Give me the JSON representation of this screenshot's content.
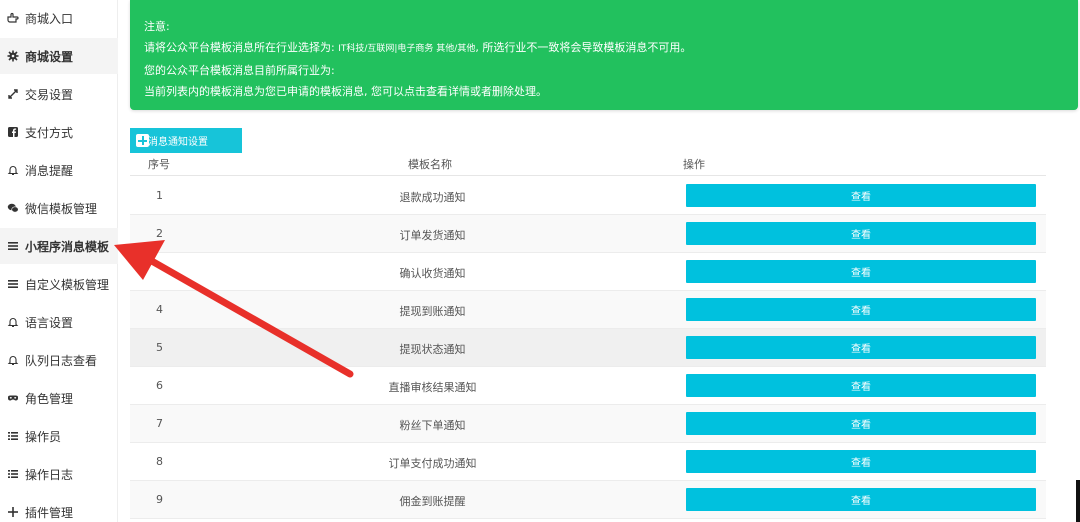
{
  "sidebar": {
    "items": [
      {
        "label": "商城入口",
        "icon": "hand-point-icon"
      },
      {
        "label": "商城设置",
        "icon": "gear-icon",
        "active": true
      },
      {
        "label": "交易设置",
        "icon": "swap-icon"
      },
      {
        "label": "支付方式",
        "icon": "facebook-square-icon"
      },
      {
        "label": "消息提醒",
        "icon": "bell-icon"
      },
      {
        "label": "微信模板管理",
        "icon": "wechat-icon"
      },
      {
        "label": "小程序消息模板",
        "icon": "list-icon",
        "highlighted": true
      },
      {
        "label": "自定义模板管理",
        "icon": "list-icon"
      },
      {
        "label": "语言设置",
        "icon": "bell-icon"
      },
      {
        "label": "队列日志查看",
        "icon": "bell-icon"
      },
      {
        "label": "角色管理",
        "icon": "mask-icon"
      },
      {
        "label": "操作员",
        "icon": "list-ul-icon"
      },
      {
        "label": "操作日志",
        "icon": "list-ul-icon"
      },
      {
        "label": "插件管理",
        "icon": "plus-icon"
      }
    ]
  },
  "notice": {
    "title": "注意:",
    "line1_prefix": "请将公众平台模板消息所在行业选择为: ",
    "line1_industry": "IT科技/互联网|电子商务  其他/其他",
    "line1_suffix": ", 所选行业不一致将会导致模板消息不可用。",
    "line2": "您的公众平台模板消息目前所属行业为:",
    "line3": "当前列表内的模板消息为您已申请的模板消息, 您可以点击查看详情或者删除处理。",
    "bg_color": "#22c15e"
  },
  "toolbar": {
    "add_label": "消息通知设置",
    "accent_color": "#17c4d9"
  },
  "table": {
    "headers": {
      "no": "序号",
      "name": "模板名称",
      "action": "操作"
    },
    "rows": [
      {
        "no": "1",
        "name": "退款成功通知",
        "action": "查看"
      },
      {
        "no": "2",
        "name": "订单发货通知",
        "action": "查看"
      },
      {
        "no": "",
        "name": "确认收货通知",
        "action": "查看"
      },
      {
        "no": "4",
        "name": "提现到账通知",
        "action": "查看"
      },
      {
        "no": "5",
        "name": "提现状态通知",
        "action": "查看"
      },
      {
        "no": "6",
        "name": "直播审核结果通知",
        "action": "查看"
      },
      {
        "no": "7",
        "name": "粉丝下单通知",
        "action": "查看"
      },
      {
        "no": "8",
        "name": "订单支付成功通知",
        "action": "查看"
      },
      {
        "no": "9",
        "name": "佣金到账提醒",
        "action": "查看"
      }
    ],
    "button_color": "#00c1de"
  },
  "annotation": {
    "arrow_color": "#e8302a"
  }
}
